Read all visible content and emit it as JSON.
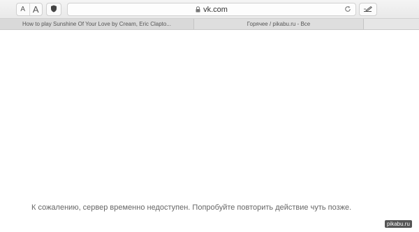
{
  "toolbar": {
    "font_small": "A",
    "font_large": "A",
    "shield_icon": "shield-icon",
    "lock_icon": "lock-icon",
    "address": "vk.com",
    "reload_icon": "reload-icon",
    "reader_icon": "reader-icon"
  },
  "tabs": [
    {
      "label": "How to play Sunshine Of Your Love by Cream, Eric Clapto..."
    },
    {
      "label": "Горячее / pikabu.ru - Все"
    }
  ],
  "main": {
    "error_message": "К сожалению, сервер временно недоступен. Попробуйте повторить действие чуть позже."
  },
  "watermark": "pikabu.ru"
}
